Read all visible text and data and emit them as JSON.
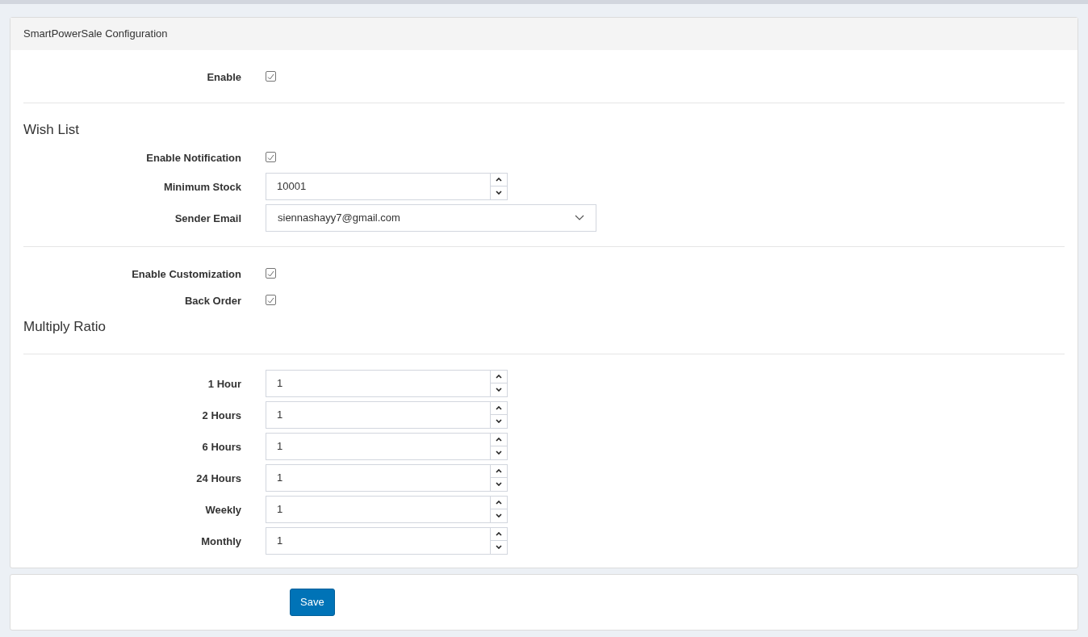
{
  "panel": {
    "title": "SmartPowerSale Configuration"
  },
  "rows": [
    {
      "kind": "checkbox",
      "label": "Enable",
      "checked": true
    },
    {
      "kind": "divider"
    },
    {
      "kind": "heading",
      "label": "Wish List"
    },
    {
      "kind": "checkbox",
      "label": "Enable Notification",
      "checked": true
    },
    {
      "kind": "number",
      "label": "Minimum Stock",
      "value": "10001"
    },
    {
      "kind": "select",
      "label": "Sender Email",
      "value": "siennashayy7@gmail.com"
    },
    {
      "kind": "divider"
    },
    {
      "kind": "checkbox",
      "label": "Enable Customization",
      "checked": true
    },
    {
      "kind": "checkbox",
      "label": "Back Order",
      "checked": true
    },
    {
      "kind": "heading",
      "label": "Multiply Ratio"
    },
    {
      "kind": "divider"
    },
    {
      "kind": "number",
      "label": "1 Hour",
      "value": "1"
    },
    {
      "kind": "number",
      "label": "2 Hours",
      "value": "1"
    },
    {
      "kind": "number",
      "label": "6 Hours",
      "value": "1"
    },
    {
      "kind": "number",
      "label": "24 Hours",
      "value": "1"
    },
    {
      "kind": "number",
      "label": "Weekly",
      "value": "1"
    },
    {
      "kind": "number",
      "label": "Monthly",
      "value": "1"
    }
  ],
  "save_button": "Save"
}
